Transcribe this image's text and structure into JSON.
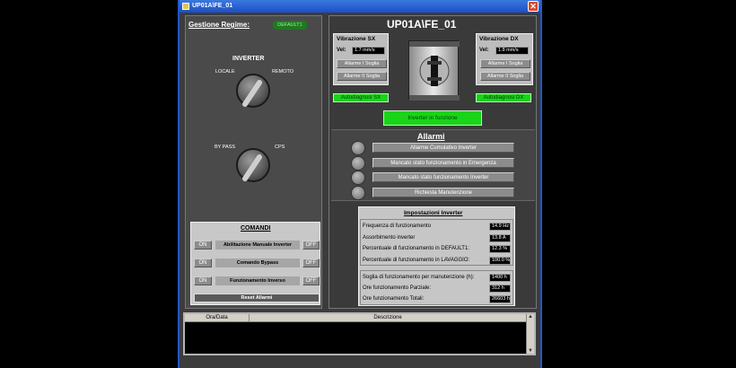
{
  "window": {
    "title": "UP01A\\FE_01",
    "close": "✕"
  },
  "left": {
    "gestione_label": "Gestione Regime:",
    "default_badge": "DEFAULT1",
    "inverter_title": "INVERTER",
    "switch1": {
      "left": "LOCALE",
      "right": "REMOTO"
    },
    "switch2": {
      "left": "BY PASS",
      "right": "CPS"
    },
    "comandi": {
      "title": "COMANDI",
      "rows": [
        {
          "on": "ON",
          "label": "Abilitazione Manuale Inverter",
          "off": "OFF"
        },
        {
          "on": "ON",
          "label": "Comando Bypass",
          "off": "OFF"
        },
        {
          "on": "ON",
          "label": "Funzionamento Inverso",
          "off": "OFF"
        }
      ],
      "reset": "Reset Allarmi"
    }
  },
  "right": {
    "title": "UP01A\\FE_01",
    "vib_sx": {
      "title": "Vibrazione SX",
      "vel_label": "Vel:",
      "vel_value": "1.7 mm/s",
      "alarm1": "Allarme I Soglia",
      "alarm2": "Allarme II Soglia"
    },
    "vib_dx": {
      "title": "Vibrazione DX",
      "vel_label": "Vel:",
      "vel_value": "1.8 mm/s",
      "alarm1": "Allarme I Soglia",
      "alarm2": "Allarme II Soglia"
    },
    "diag_sx": "Autodiagnosi SX",
    "diag_dx": "Autodiagnosi DX",
    "inverter_status": "Inverter in funzione",
    "allarmi": {
      "title": "Allarmi",
      "items": [
        "Allarme Cumulativo Inverter",
        "Mancato stato funzionamento in Emergenza",
        "Mancato stato funzionamento Inverter",
        "Richiesta Manutenzione"
      ]
    },
    "impostazioni": {
      "title": "Impostazioni Inverter",
      "rows1": [
        {
          "label": "Frequenza di funzionamento",
          "value": "14.9 Hz"
        },
        {
          "label": "Assorbimento inverter",
          "value": "13.8 A"
        },
        {
          "label": "Percentuale di funzionamento in DEFAULT1:",
          "value": "12.3 %"
        },
        {
          "label": "Percentuale di funzionamento in LAVAGGIO:",
          "value": "100.0 %"
        }
      ],
      "rows2": [
        {
          "label": "Soglia di funzionamento per manutenzione (h):",
          "value": "1400 h"
        },
        {
          "label": "Ore funzionamento Parziale:",
          "value": "312 h"
        },
        {
          "label": "Ore funzionamento Totali:",
          "value": "26603 h"
        }
      ]
    }
  },
  "log": {
    "col1": "Ora/Data",
    "col2": "Descrizione",
    "up": "▲",
    "down": "▼"
  }
}
